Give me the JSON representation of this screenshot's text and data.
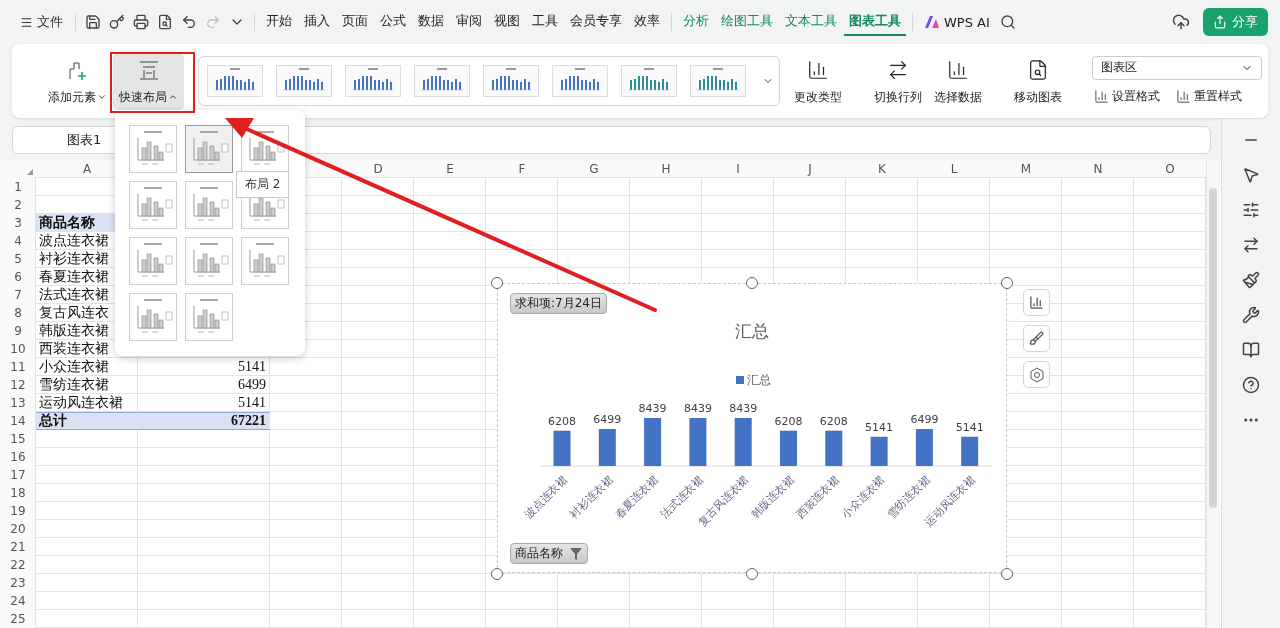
{
  "top_bar": {
    "menu_button": {
      "label": "文件"
    },
    "quick_actions": [
      {
        "disabled": false
      },
      {
        "disabled": false
      },
      {
        "disabled": false
      },
      {
        "disabled": false
      },
      {
        "disabled": false
      },
      {
        "disabled": true
      },
      {
        "disabled": false
      }
    ],
    "tabs": [
      {
        "label": "开始",
        "selected": false,
        "kind": "normal"
      },
      {
        "label": "插入",
        "selected": false,
        "kind": "normal"
      },
      {
        "label": "页面",
        "selected": false,
        "kind": "normal"
      },
      {
        "label": "公式",
        "selected": false,
        "kind": "normal"
      },
      {
        "label": "数据",
        "selected": false,
        "kind": "normal"
      },
      {
        "label": "审阅",
        "selected": false,
        "kind": "normal"
      },
      {
        "label": "视图",
        "selected": false,
        "kind": "normal"
      },
      {
        "label": "工具",
        "selected": false,
        "kind": "normal"
      },
      {
        "label": "会员专享",
        "selected": false,
        "kind": "normal"
      },
      {
        "label": "效率",
        "selected": false,
        "kind": "normal"
      },
      {
        "label": "分析",
        "selected": false,
        "kind": "context"
      },
      {
        "label": "绘图工具",
        "selected": false,
        "kind": "context"
      },
      {
        "label": "文本工具",
        "selected": false,
        "kind": "context"
      },
      {
        "label": "图表工具",
        "selected": true,
        "kind": "context"
      }
    ],
    "ai_button": {
      "label": "WPS AI"
    },
    "share_button": {
      "label": "分享"
    }
  },
  "ribbon": {
    "element_button": {
      "label": "添加元素"
    },
    "layout_button": {
      "label": "快速布局",
      "expanded": true
    },
    "styles": [
      {
        "color": "#4472c4"
      },
      {
        "color": "#4472c4"
      },
      {
        "color": "#4472c4"
      },
      {
        "color": "#4472c4"
      },
      {
        "color": "#4472c4"
      },
      {
        "color": "#4472c4"
      },
      {
        "color": "#2e8b9a"
      },
      {
        "color": "#2e8b9a"
      }
    ],
    "tool_groups": [
      {
        "buttons": [
          {
            "label": "更改类型"
          }
        ]
      },
      {
        "buttons": [
          {
            "label": "切换行列"
          },
          {
            "label": "选择数据"
          }
        ]
      },
      {
        "buttons": [
          {
            "label": "移动图表"
          }
        ]
      }
    ],
    "element_select": {
      "value": "图表区"
    },
    "format_buttons": [
      {
        "label": "设置格式"
      },
      {
        "label": "重置样式"
      }
    ]
  },
  "name_box": {
    "value": "图表1"
  },
  "columns": [
    {
      "label": "A"
    },
    {},
    {},
    {
      "label": "D"
    },
    {
      "label": "E"
    },
    {
      "label": "F"
    },
    {
      "label": "G"
    },
    {
      "label": "H"
    },
    {
      "label": "I"
    },
    {
      "label": "J"
    },
    {
      "label": "K"
    },
    {
      "label": "L"
    },
    {
      "label": "M"
    },
    {
      "label": "N"
    },
    {
      "label": "O"
    }
  ],
  "rows": [
    {
      "number": "1"
    },
    {
      "number": "2"
    },
    {
      "number": "3",
      "kind": "header",
      "cells": [
        "商品名称"
      ]
    },
    {
      "number": "4",
      "cells": [
        "波点连衣裙"
      ]
    },
    {
      "number": "5",
      "cells": [
        "衬衫连衣裙"
      ]
    },
    {
      "number": "6",
      "cells": [
        "春夏连衣裙"
      ]
    },
    {
      "number": "7",
      "cells": [
        "法式连衣裙"
      ]
    },
    {
      "number": "8",
      "cells": [
        "复古风连衣"
      ]
    },
    {
      "number": "9",
      "cells": [
        "韩版连衣裙"
      ]
    },
    {
      "number": "10",
      "cells": [
        "西装连衣裙"
      ]
    },
    {
      "number": "11",
      "cells": [
        "小众连衣裙",
        "5141"
      ]
    },
    {
      "number": "12",
      "cells": [
        "雪纺连衣裙",
        "6499"
      ]
    },
    {
      "number": "13",
      "cells": [
        "运动风连衣裙",
        "5141"
      ]
    },
    {
      "number": "14",
      "kind": "total",
      "cells": [
        "总计",
        "67221"
      ]
    },
    {
      "number": "15"
    },
    {
      "number": "16"
    },
    {
      "number": "17"
    },
    {
      "number": "18"
    },
    {
      "number": "19"
    },
    {
      "number": "20"
    },
    {
      "number": "21"
    },
    {
      "number": "22"
    },
    {
      "number": "23"
    },
    {
      "number": "24"
    },
    {
      "number": "25"
    }
  ],
  "layout_menu": {
    "layouts": [
      {
        "selected": false
      },
      {
        "selected": true
      },
      {
        "selected": false
      },
      {
        "selected": false
      },
      {
        "selected": false
      },
      {
        "selected": false
      },
      {
        "selected": false
      },
      {
        "selected": false
      },
      {
        "selected": false
      },
      {
        "selected": false
      },
      {
        "selected": false
      }
    ],
    "tooltip": "布局 2"
  },
  "chart": {
    "value_field": "求和项:7月24日",
    "category_field": "商品名称",
    "chart_data": {
      "type": "bar",
      "title": "汇总",
      "categories": [
        "波点连衣裙",
        "衬衫连衣裙",
        "春夏连衣裙",
        "法式连衣裙",
        "复古风连衣裙",
        "韩版连衣裙",
        "西装连衣裙",
        "小众连衣裙",
        "雪纺连衣裙",
        "运动风连衣裙"
      ],
      "series": [
        {
          "name": "汇总",
          "color": "#4472c4",
          "values": [
            6208,
            6499,
            8439,
            8439,
            8439,
            6208,
            6208,
            5141,
            6499,
            5141
          ]
        }
      ],
      "data_labels": true
    }
  }
}
